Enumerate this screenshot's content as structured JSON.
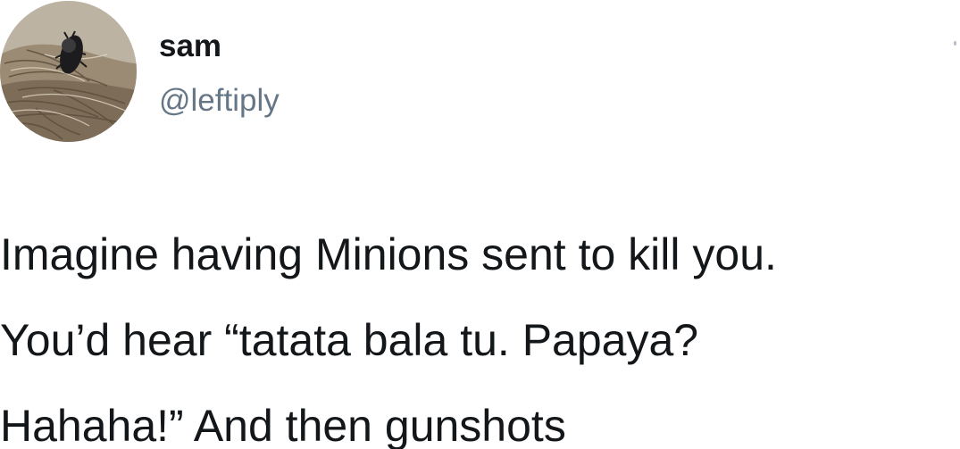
{
  "tweet": {
    "author": {
      "display_name": "sam",
      "handle": "@leftiply",
      "avatar_icon": "beetle-on-straw-avatar"
    },
    "text_lines": [
      "Imagine having Minions sent to kill you.",
      "You’d hear “tatata bala tu. Papaya?",
      "Hahaha!” And then gunshots"
    ]
  },
  "colors": {
    "background": "#ffffff",
    "text_primary": "#14171a",
    "text_secondary": "#657786"
  }
}
